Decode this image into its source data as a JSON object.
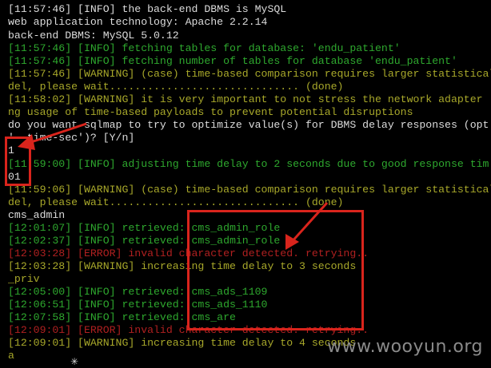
{
  "terminal": {
    "lines": [
      {
        "text": "[11:57:46] [INFO] the back-end DBMS is MySQL",
        "color": "white"
      },
      {
        "text": "web application technology: Apache 2.2.14",
        "color": "white"
      },
      {
        "text": "back-end DBMS: MySQL 5.0.12",
        "color": "white"
      },
      {
        "text": "[11:57:46] [INFO] fetching tables for database: 'endu_patient'",
        "color": "green"
      },
      {
        "text": "[11:57:46] [INFO] fetching number of tables for database 'endu_patient'",
        "color": "green"
      },
      {
        "text": "[11:57:46] [WARNING] (case) time-based comparison requires larger statistical",
        "color": "olive"
      },
      {
        "text": "del, please wait.............................. (done)",
        "color": "olive"
      },
      {
        "text": "[11:58:02] [WARNING] it is very important to not stress the network adapter",
        "color": "olive"
      },
      {
        "text": "ng usage of time-based payloads to prevent potential disruptions",
        "color": "olive"
      },
      {
        "text": "do you want sqlmap to try to optimize value(s) for DBMS delay responses (opt",
        "color": "white"
      },
      {
        "text": "'--time-sec')? [Y/n]",
        "color": "white"
      },
      {
        "text": "1",
        "color": "white"
      },
      {
        "text": "[11:59:00] [INFO] adjusting time delay to 2 seconds due to good response tim",
        "color": "green"
      },
      {
        "text": "01",
        "color": "white"
      },
      {
        "text": "[11:59:06] [WARNING] (case) time-based comparison requires larger statistical",
        "color": "olive"
      },
      {
        "text": "del, please wait.............................. (done)",
        "color": "olive"
      },
      {
        "text": "cms_admin",
        "color": "white"
      },
      {
        "text": "[12:01:07] [INFO] retrieved: cms_admin_role",
        "color": "green"
      },
      {
        "text": "[12:02:37] [INFO] retrieved: cms_admin_role",
        "color": "green"
      },
      {
        "text": "[12:03:28] [ERROR] invalid character detected. retrying..",
        "color": "red"
      },
      {
        "text": "[12:03:28] [WARNING] increasing time delay to 3 seconds",
        "color": "olive"
      },
      {
        "text": "_priv",
        "color": "olive"
      },
      {
        "text": "[12:05:00] [INFO] retrieved: cms_ads_1109",
        "color": "green"
      },
      {
        "text": "[12:06:51] [INFO] retrieved: cms_ads_1110",
        "color": "green"
      },
      {
        "text": "[12:07:58] [INFO] retrieved: cms_are",
        "color": "green"
      },
      {
        "text": "[12:09:01] [ERROR] invalid character detected. retrying..",
        "color": "red"
      },
      {
        "text": "[12:09:01] [WARNING] increasing time delay to 4 seconds",
        "color": "olive"
      },
      {
        "text": "a",
        "color": "olive"
      }
    ]
  },
  "annotations": {
    "box_color": "#d9241c"
  },
  "watermark": {
    "text": "www.wooyun.org"
  }
}
